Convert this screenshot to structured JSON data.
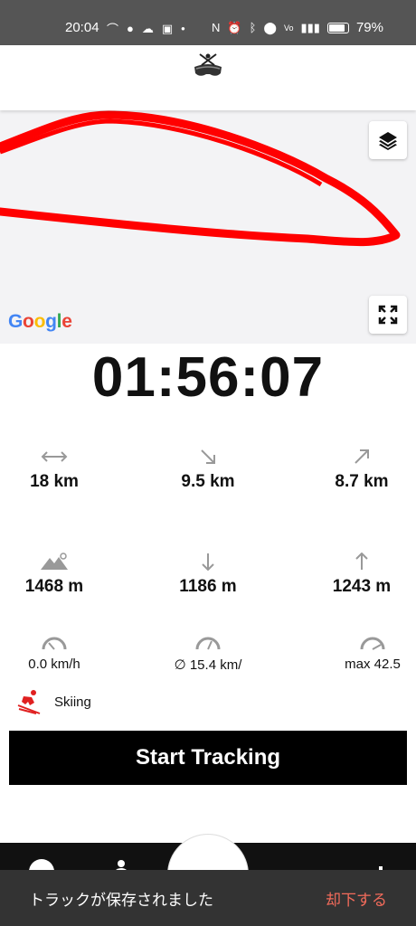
{
  "status_bar": {
    "time": "20:04",
    "battery": "79%",
    "icons_left": [
      "trail-icon",
      "line-icon",
      "cloud-icon",
      "camera-icon",
      "dot-icon"
    ],
    "icons_right": [
      "nfc-icon",
      "alarm-icon",
      "bluetooth-icon",
      "location-icon",
      "volte-icon",
      "signal-5g-icon",
      "battery-icon"
    ]
  },
  "map": {
    "attribution": "Google",
    "track_color": "#ff0000"
  },
  "timer": "01:56:07",
  "stats": {
    "distance": "18 km",
    "descent_distance": "9.5 km",
    "ascent_distance": "8.7 km",
    "max_altitude": "1468 m",
    "descent": "1186 m",
    "ascent": "1243 m",
    "current_speed": "0.0 km/h",
    "avg_speed": "∅ 15.4 km/",
    "max_speed": "max 42.5"
  },
  "activity": {
    "label": "Skiing",
    "accent": "#e02020"
  },
  "start_button": "Start Tracking",
  "toast": {
    "message": "トラックが保存されました",
    "action": "却下する",
    "action_color": "#f26b5b"
  }
}
